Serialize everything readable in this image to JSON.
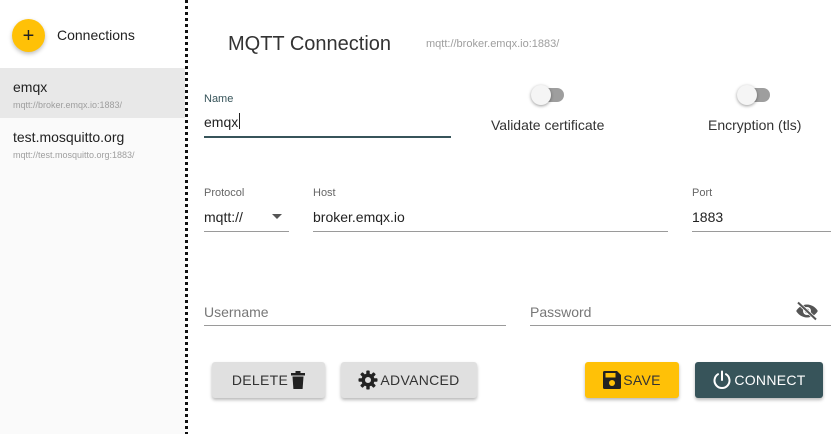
{
  "sidebar": {
    "add_icon": "plus-icon",
    "add_glyph": "+",
    "title": "Connections",
    "items": [
      {
        "name": "emqx",
        "url": "mqtt://broker.emqx.io:1883/",
        "selected": true
      },
      {
        "name": "test.mosquitto.org",
        "url": "mqtt://test.mosquitto.org:1883/",
        "selected": false
      }
    ]
  },
  "header": {
    "title": "MQTT Connection",
    "url": "mqtt://broker.emqx.io:1883/"
  },
  "form": {
    "name": {
      "label": "Name",
      "value": "emqx"
    },
    "validate_certificate": {
      "label": "Validate certificate",
      "enabled": false
    },
    "encryption": {
      "label": "Encryption (tls)",
      "enabled": false
    },
    "protocol": {
      "label": "Protocol",
      "value": "mqtt://"
    },
    "host": {
      "label": "Host",
      "value": "broker.emqx.io"
    },
    "port": {
      "label": "Port",
      "value": "1883"
    },
    "username": {
      "placeholder": "Username",
      "value": ""
    },
    "password": {
      "placeholder": "Password",
      "value": "",
      "visibility_icon": "eye-off-icon"
    }
  },
  "buttons": {
    "delete": {
      "label": "DELETE",
      "icon": "trash-icon"
    },
    "advanced": {
      "label": "ADVANCED",
      "icon": "gear-icon"
    },
    "save": {
      "label": "SAVE",
      "icon": "floppy-disk-icon"
    },
    "connect": {
      "label": "CONNECT",
      "icon": "power-icon"
    }
  },
  "colors": {
    "accent_yellow": "#ffc107",
    "primary_teal": "#37545a",
    "selected_row": "#e8e8e8",
    "sidebar_bg": "#fafafa"
  }
}
